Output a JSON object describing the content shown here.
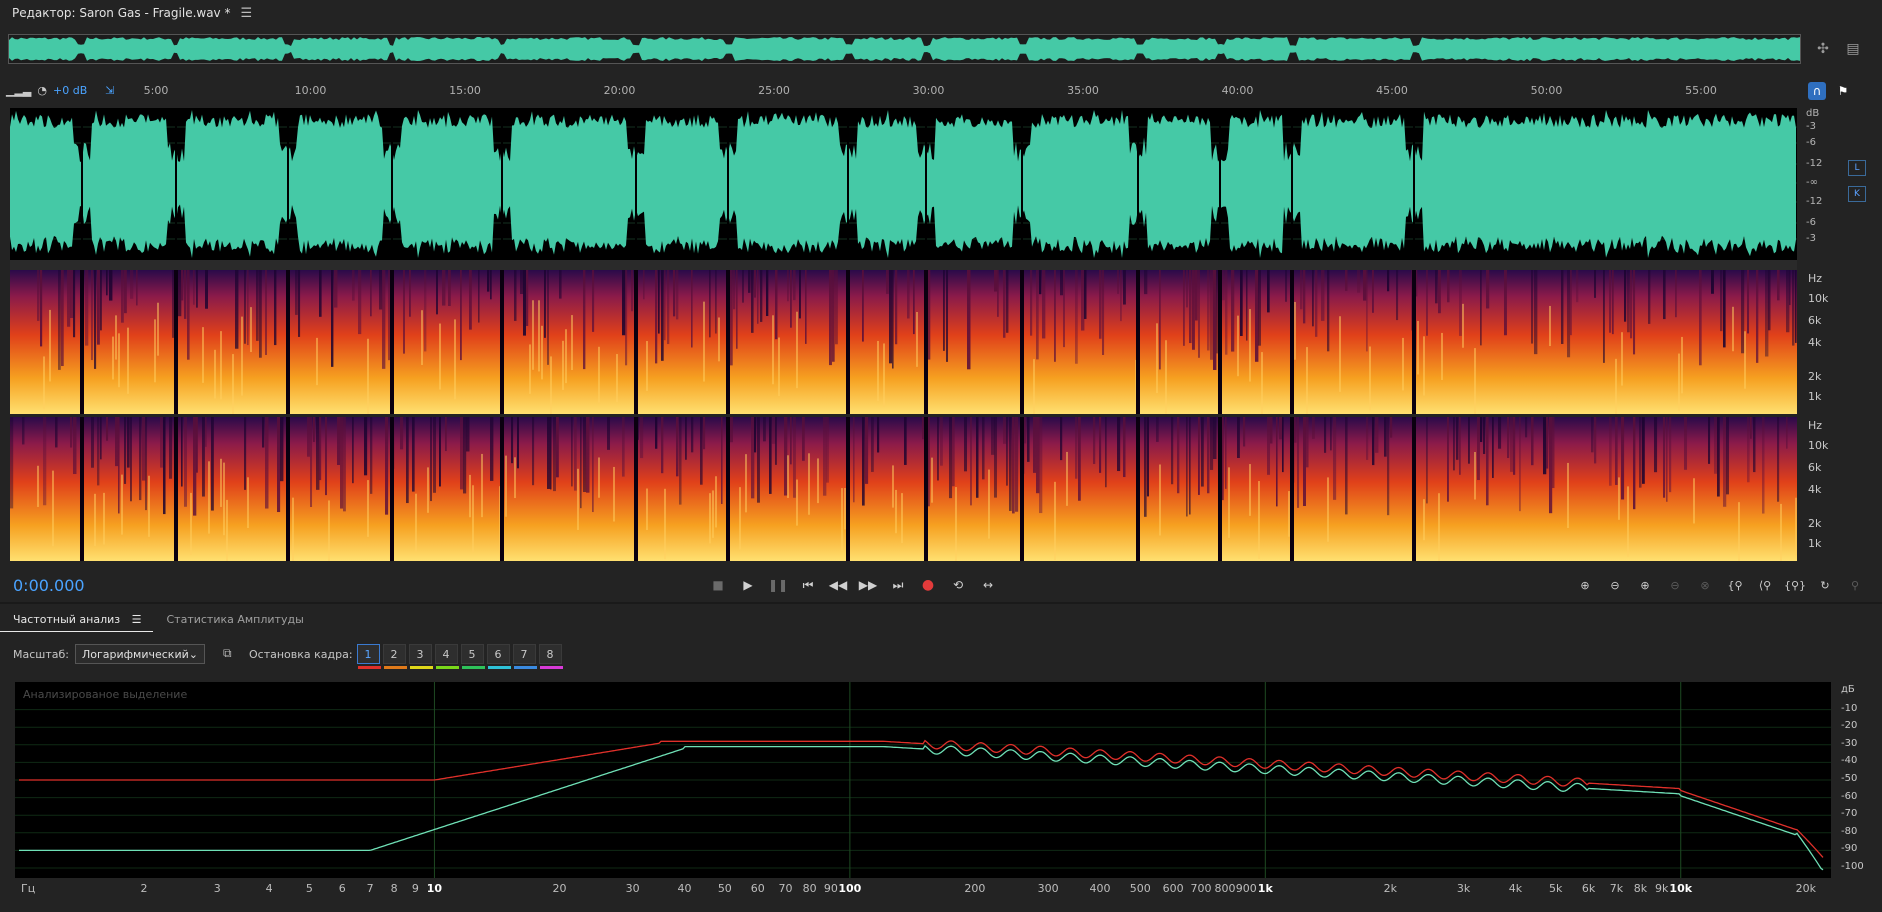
{
  "title": {
    "text": "Редактор: Saron Gas - Fragile.wav *",
    "menu_icon": "☰"
  },
  "ruler": {
    "level": "+0 dB",
    "ticks": [
      "5:00",
      "10:00",
      "15:00",
      "20:00",
      "25:00",
      "30:00",
      "35:00",
      "40:00",
      "45:00",
      "50:00",
      "55:00"
    ]
  },
  "wave_db": {
    "unit": "dB",
    "labels_top": [
      "-3",
      "-6",
      "-12",
      "-∞"
    ],
    "labels_bottom": [
      "-12",
      "-6",
      "-3"
    ]
  },
  "channels": {
    "left": "L",
    "right": "K"
  },
  "spectral": {
    "unit": "Hz",
    "labels": [
      "10k",
      "6k",
      "4k",
      "2k",
      "1k"
    ]
  },
  "colors": {
    "wave": "#45c9a6",
    "accent": "#4aa3ff",
    "line_red": "#e0302a",
    "line_green": "#6fe0b6",
    "frame_colors": [
      "#e0302a",
      "#e07a1a",
      "#e0d81a",
      "#7ad81a",
      "#2ec25a",
      "#2ec2d8",
      "#3a8ae0",
      "#d83ad8"
    ]
  },
  "transport": {
    "timecode": "0:00.000",
    "buttons": [
      "stop",
      "play",
      "pause",
      "go-to-start",
      "rewind",
      "fast-forward",
      "go-to-end",
      "record",
      "loop",
      "skip"
    ]
  },
  "tabs": [
    {
      "label": "Частотный анализ",
      "active": true
    },
    {
      "label": "Статистика Амплитуды",
      "active": false
    }
  ],
  "controls": {
    "scale_label": "Масштаб:",
    "scale_value": "Логарифмический",
    "freeze_label": "Остановка кадра:",
    "frames": [
      "1",
      "2",
      "3",
      "4",
      "5",
      "6",
      "7",
      "8"
    ],
    "active_frame": "1"
  },
  "freq_plot": {
    "caption": "Анализированое выделение",
    "db_unit": "дБ",
    "db_labels": [
      "-10",
      "-20",
      "-30",
      "-40",
      "-50",
      "-60",
      "-70",
      "-80",
      "-90",
      "-100"
    ],
    "x_unit": "Гц",
    "x_labels": [
      "2",
      "3",
      "4",
      "5",
      "6",
      "7",
      "8",
      "9",
      "10",
      "20",
      "30",
      "40",
      "50",
      "60",
      "70",
      "80",
      "90",
      "100",
      "200",
      "300",
      "400",
      "500",
      "600",
      "700",
      "800",
      "900",
      "1k",
      "2k",
      "3k",
      "4k",
      "5k",
      "6k",
      "7k",
      "8k",
      "9k",
      "10k",
      "20k"
    ]
  }
}
